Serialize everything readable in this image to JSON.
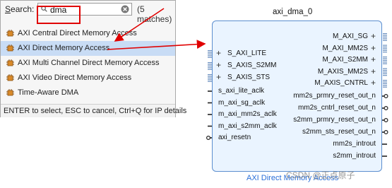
{
  "search": {
    "label": "Search:",
    "label_shortcut": "S",
    "label_rest": "earch:",
    "value": "dma",
    "match_count": "(5 matches)"
  },
  "results": [
    {
      "label": "AXI Central Direct Memory Access",
      "selected": false
    },
    {
      "label": "AXI Direct Memory Access",
      "selected": true
    },
    {
      "label": "AXI Multi Channel Direct Memory Access",
      "selected": false
    },
    {
      "label": "AXI Video Direct Memory Access",
      "selected": false
    },
    {
      "label": "Time-Aware DMA",
      "selected": false
    }
  ],
  "status_bar": "ENTER to select, ESC to cancel, Ctrl+Q for IP details",
  "block": {
    "instance_name": "axi_dma_0",
    "caption": "AXI Direct Memory Access",
    "left_bus_ports": [
      "S_AXI_LITE",
      "S_AXIS_S2MM",
      "S_AXIS_STS"
    ],
    "left_ports": [
      "s_axi_lite_aclk",
      "m_axi_sg_aclk",
      "m_axi_mm2s_aclk",
      "m_axi_s2mm_aclk",
      "axi_resetn"
    ],
    "right_bus_ports": [
      "M_AXI_SG",
      "M_AXI_MM2S",
      "M_AXI_S2MM",
      "M_AXIS_MM2S",
      "M_AXIS_CNTRL"
    ],
    "right_ports": [
      "mm2s_prmry_reset_out_n",
      "mm2s_cntrl_reset_out_n",
      "s2mm_prmry_reset_out_n",
      "s2mm_sts_reset_out_n",
      "mm2s_introut",
      "s2mm_introut"
    ]
  },
  "watermark": "CSDN @正点原子",
  "colors": {
    "annotation_red": "#e00000",
    "selection": "#c8dcf5",
    "block_fill": "#eaf4ff",
    "block_border": "#5c8fcf"
  }
}
